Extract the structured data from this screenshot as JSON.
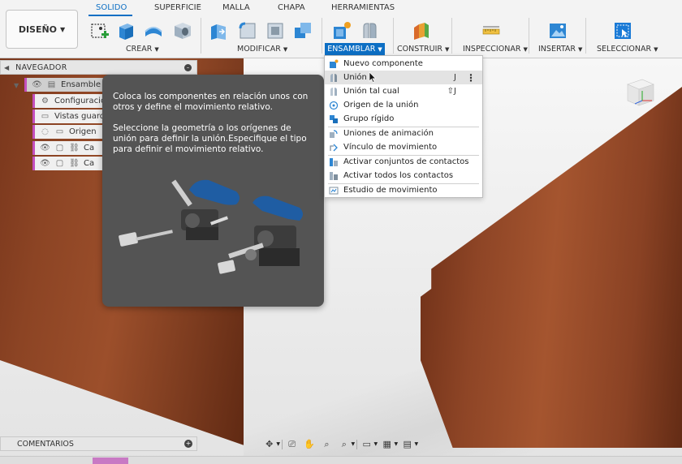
{
  "toolbar": {
    "design_label": "DISEÑO",
    "tabs": [
      "SOLIDO",
      "SUPERFICIE",
      "MALLA",
      "CHAPA",
      "HERRAMIENTAS"
    ],
    "active_tab": "SOLIDO",
    "groups": [
      "CREAR",
      "MODIFICAR",
      "ENSAMBLAR",
      "CONSTRUIR",
      "INSPECCIONAR",
      "INSERTAR",
      "SELECCIONAR"
    ],
    "active_group": "ENSAMBLAR",
    "accent_color": "#0d6fc4"
  },
  "navigator": {
    "title": "NAVEGADOR",
    "items": [
      {
        "label": "Ensamble",
        "icon": "component-icon"
      },
      {
        "label": "Configuració",
        "icon": "gear-icon"
      },
      {
        "label": "Vistas guarda",
        "icon": "folder-icon"
      },
      {
        "label": "Origen",
        "icon": "folder-icon"
      },
      {
        "label": "Ca",
        "icon": "link-icon"
      },
      {
        "label": "Ca",
        "icon": "link-icon"
      }
    ]
  },
  "tooltip": {
    "paragraph1": "Coloca los componentes en relación unos con otros y define el movimiento relativo.",
    "paragraph2": "Seleccione la geometría o los orígenes de unión para definir la unión.Especifique el tipo para definir el movimiento relativo."
  },
  "menu": {
    "items": [
      {
        "label": "Nuevo componente",
        "icon": "new-component-icon",
        "shortcut": ""
      },
      {
        "label": "Unión",
        "icon": "joint-icon",
        "shortcut": "J"
      },
      {
        "label": "Unión tal cual",
        "icon": "as-built-joint-icon",
        "shortcut": "⇧J"
      },
      {
        "label": "Origen de la unión",
        "icon": "joint-origin-icon",
        "shortcut": ""
      },
      {
        "label": "Grupo rígido",
        "icon": "rigid-group-icon",
        "shortcut": ""
      },
      {
        "label": "Uniones de animación",
        "icon": "animate-joints-icon",
        "shortcut": ""
      },
      {
        "label": "Vínculo de movimiento",
        "icon": "motion-link-icon",
        "shortcut": ""
      },
      {
        "label": "Activar conjuntos de contactos",
        "icon": "contact-sets-icon",
        "shortcut": ""
      },
      {
        "label": "Activar todos los contactos",
        "icon": "all-contacts-icon",
        "shortcut": ""
      },
      {
        "label": "Estudio de movimiento",
        "icon": "motion-study-icon",
        "shortcut": ""
      }
    ],
    "highlighted": "Unión"
  },
  "bottom": {
    "comments_label": "COMENTARIOS"
  }
}
